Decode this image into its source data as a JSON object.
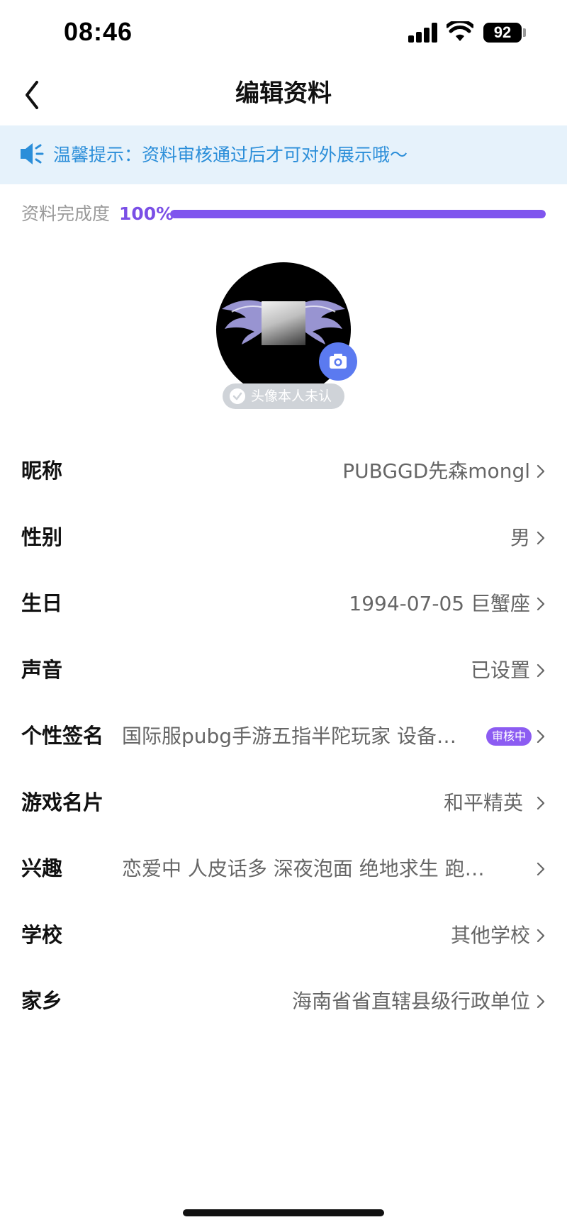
{
  "status_bar": {
    "time": "08:46",
    "battery": "92"
  },
  "nav": {
    "title": "编辑资料"
  },
  "notice": {
    "text": "温馨提示：资料审核通过后才可对外展示哦～"
  },
  "completeness": {
    "label": "资料完成度",
    "percent_text": "100%",
    "percent": 1.0
  },
  "avatar": {
    "verify_text": "头像本人未认证"
  },
  "profile_rows": [
    {
      "label": "昵称",
      "value": "PUBGGD先森mongl"
    },
    {
      "label": "性别",
      "value": "男"
    },
    {
      "label": "生日",
      "value": "1994-07-05 巨蟹座"
    },
    {
      "label": "声音",
      "value": "已设置"
    },
    {
      "label": "个性签名",
      "value": "国际服pubg手游五指半陀玩家 设备…",
      "badge": "审核中"
    },
    {
      "label": "游戏名片",
      "value": "和平精英"
    },
    {
      "label": "兴趣",
      "value": "恋爱中 人皮话多 深夜泡面 绝地求生 跑…"
    },
    {
      "label": "学校",
      "value": "其他学校"
    },
    {
      "label": "家乡",
      "value": "海南省省直辖县级行政单位"
    }
  ],
  "colors": {
    "accent": "#7f55ee",
    "notice_text": "#2b8ed9",
    "notice_bg": "#e6f2fb",
    "camera": "#5b7af0"
  }
}
